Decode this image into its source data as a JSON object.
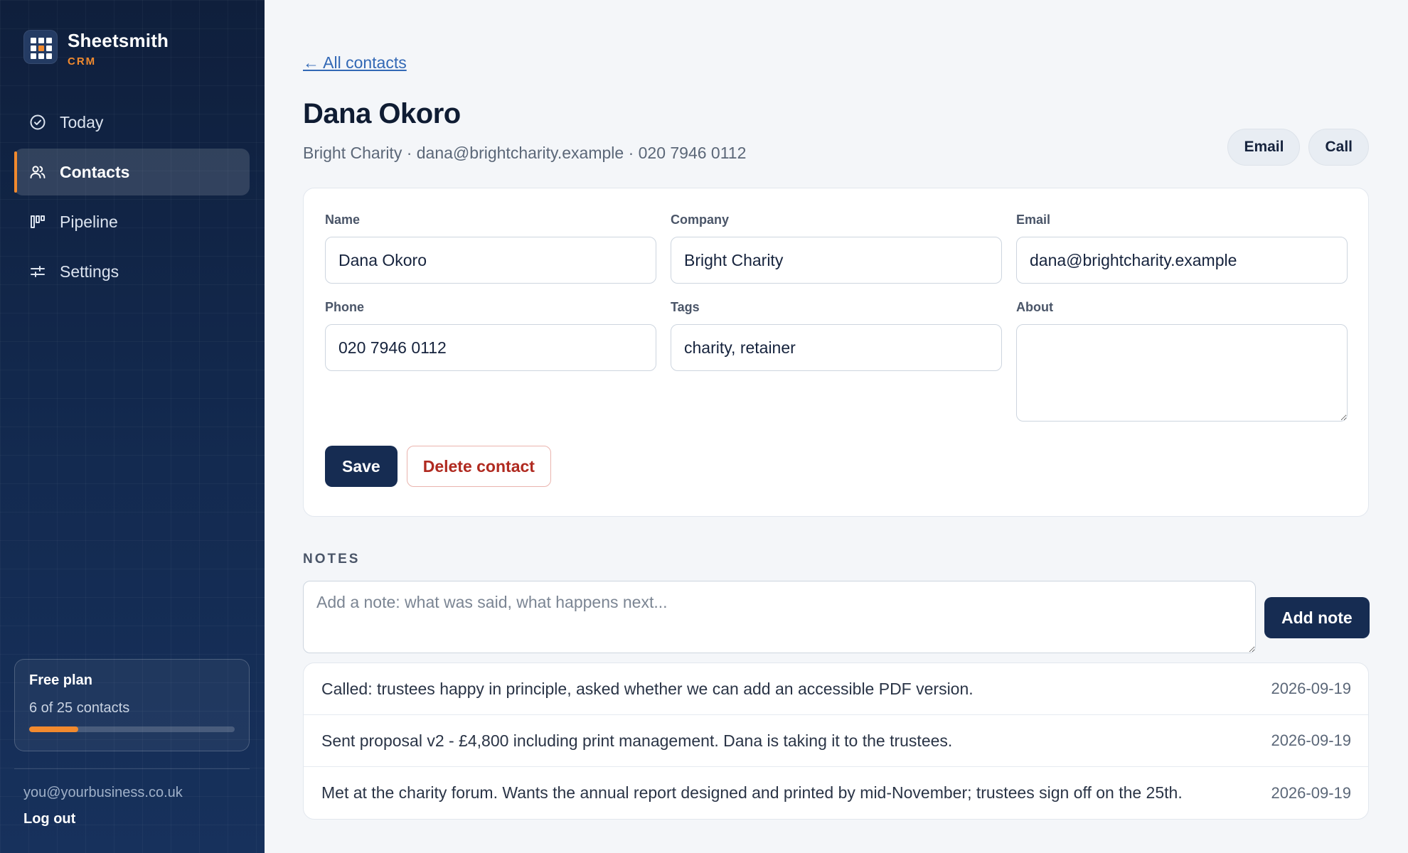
{
  "brand": {
    "name": "Sheetsmith",
    "sub": "CRM"
  },
  "nav": {
    "items": [
      {
        "label": "Today",
        "icon": "check-circle-icon"
      },
      {
        "label": "Contacts",
        "icon": "users-icon",
        "active": true
      },
      {
        "label": "Pipeline",
        "icon": "kanban-icon"
      },
      {
        "label": "Settings",
        "icon": "sliders-icon"
      }
    ]
  },
  "plan": {
    "title": "Free plan",
    "count_text": "6 of 25 contacts",
    "used": 6,
    "limit": 25
  },
  "account": {
    "email": "you@yourbusiness.co.uk",
    "logout_label": "Log out"
  },
  "header": {
    "back_label": "← All contacts",
    "title": "Dana Okoro",
    "subtitle": "Bright Charity · dana@brightcharity.example · 020 7946 0112",
    "email_label": "Email",
    "call_label": "Call"
  },
  "form": {
    "name": {
      "label": "Name",
      "value": "Dana Okoro"
    },
    "company": {
      "label": "Company",
      "value": "Bright Charity"
    },
    "email": {
      "label": "Email",
      "value": "dana@brightcharity.example"
    },
    "phone": {
      "label": "Phone",
      "value": "020 7946 0112"
    },
    "tags": {
      "label": "Tags",
      "value": "charity, retainer"
    },
    "about": {
      "label": "About",
      "value": ""
    },
    "save_label": "Save",
    "delete_label": "Delete contact"
  },
  "notes": {
    "heading": "NOTES",
    "placeholder": "Add a note: what was said, what happens next...",
    "add_label": "Add note",
    "items": [
      {
        "text": "Called: trustees happy in principle, asked whether we can add an accessible PDF version.",
        "date": "2026-09-19"
      },
      {
        "text": "Sent proposal v2 - £4,800 including print management. Dana is taking it to the trustees.",
        "date": "2026-09-19"
      },
      {
        "text": "Met at the charity forum. Wants the annual report designed and printed by mid-November; trustees sign off on the 25th.",
        "date": "2026-09-19"
      }
    ]
  },
  "colors": {
    "accent": "#f28a2e",
    "primary": "#162c52",
    "danger": "#b02a20",
    "link": "#3268b5"
  }
}
